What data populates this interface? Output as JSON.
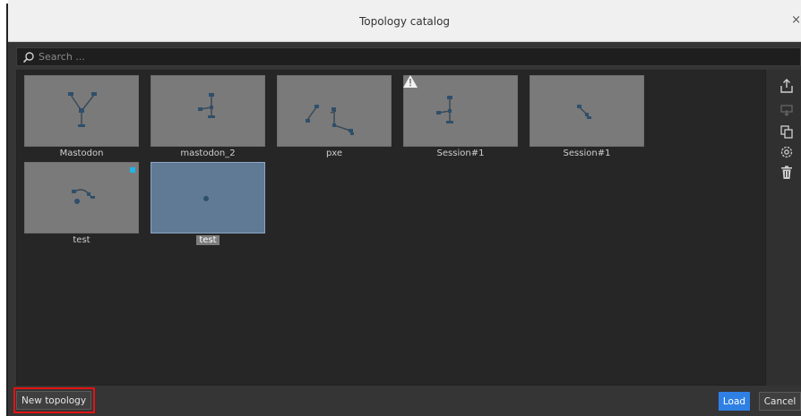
{
  "window": {
    "title": "Topology catalog",
    "close_glyph": "×"
  },
  "search": {
    "placeholder": "Search ..."
  },
  "tiles": [
    {
      "label": "Mastodon"
    },
    {
      "label": "mastodon_2"
    },
    {
      "label": "pxe"
    },
    {
      "label": "Session#1",
      "badge": "warning-icon"
    },
    {
      "label": "Session#1"
    },
    {
      "label": "test",
      "badge": "blue-dot"
    },
    {
      "label": "test",
      "selected": true
    }
  ],
  "toolbar": {
    "icons": [
      "export-icon",
      "import-icon",
      "duplicate-icon",
      "settings-icon",
      "delete-icon"
    ]
  },
  "footer": {
    "new_topology_label": "New topology",
    "load_label": "Load",
    "cancel_label": "Cancel"
  },
  "colors": {
    "accent": "#2f80e4",
    "highlight": "#e41212",
    "dot": "#1fb5e8"
  }
}
